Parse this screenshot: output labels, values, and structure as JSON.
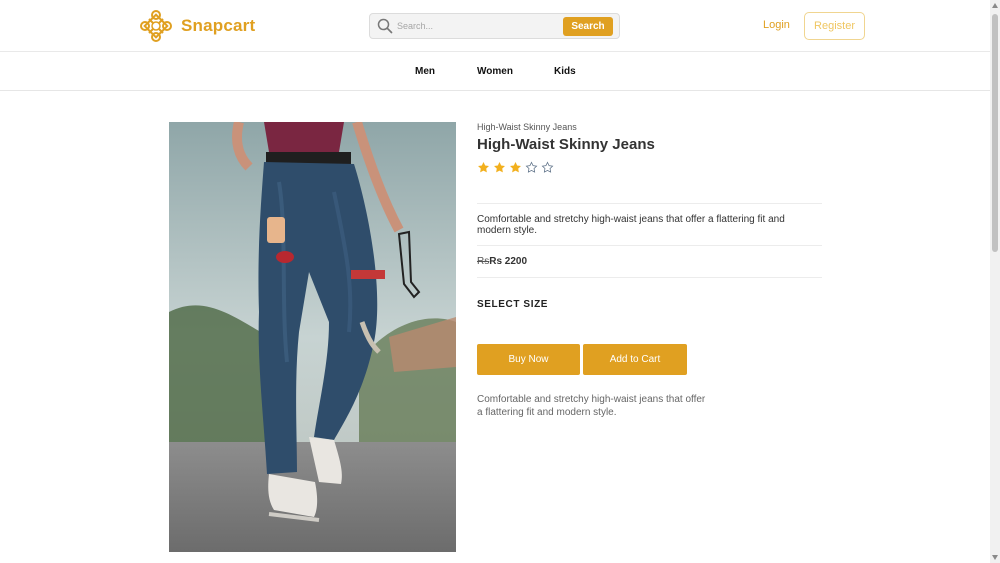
{
  "brand": {
    "name": "Snapcart",
    "color": "#e0a021"
  },
  "search": {
    "placeholder": "Search...",
    "button_label": "Search"
  },
  "auth": {
    "login_label": "Login",
    "register_label": "Register"
  },
  "nav": {
    "items": [
      {
        "label": "Men"
      },
      {
        "label": "Women"
      },
      {
        "label": "Kids"
      }
    ]
  },
  "product": {
    "breadcrumb": "High-Waist Skinny Jeans",
    "title": "High-Waist Skinny Jeans",
    "rating": 3,
    "rating_max": 5,
    "description": "Comfortable and stretchy high-waist jeans that offer a flattering fit and modern style.",
    "price_strikethrough": "Rs",
    "price": "Rs 2200",
    "size_label": "SELECT SIZE",
    "buy_now_label": "Buy Now",
    "add_to_cart_label": "Add to Cart",
    "description_secondary": "Comfortable and stretchy high-waist jeans that offer a flattering fit and modern style.",
    "image": {
      "icon": "product-photo-jeans"
    }
  },
  "colors": {
    "accent": "#e0a021",
    "star": "#f2b01e"
  }
}
